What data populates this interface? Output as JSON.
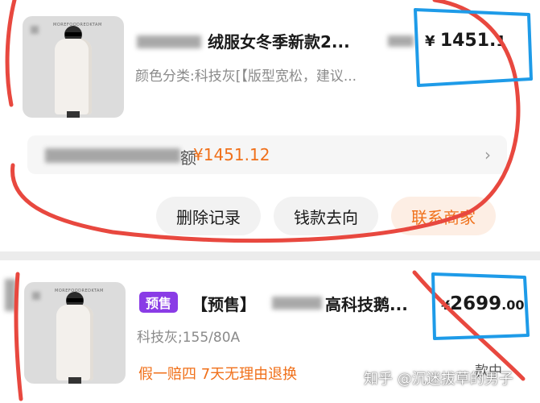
{
  "order1": {
    "title": "绒服女冬季新款2...",
    "price_symbol": "¥",
    "price_main": "1451.",
    "price_tail": "1",
    "desc": "颜色分类:科技灰[【版型宽松，建议...",
    "refund_prefix": "额",
    "refund_amount": "¥1451.12",
    "buttons": {
      "delete": "删除记录",
      "money": "钱款去向",
      "contact": "联系商家"
    },
    "thumb_text": "MOREFOODREDKTAM"
  },
  "order2": {
    "badge": "预售",
    "title_start": "【预售】",
    "title_end": "高科技鹅...",
    "price_symbol": "¥",
    "price_main": "2699",
    "price_decimals": ".00",
    "spec": "科技灰;155/80A",
    "promo": "假一赔四 7天无理由退换",
    "status": "款中",
    "thumb_text": "MOREFOODREDKTAM"
  },
  "watermark": "知乎 @沉迷拔草的男子",
  "colors": {
    "accent_orange": "#f0701a",
    "presale_purple": "#8a3ce6",
    "annotation_red": "#e8483f",
    "annotation_blue": "#1e9be8"
  }
}
